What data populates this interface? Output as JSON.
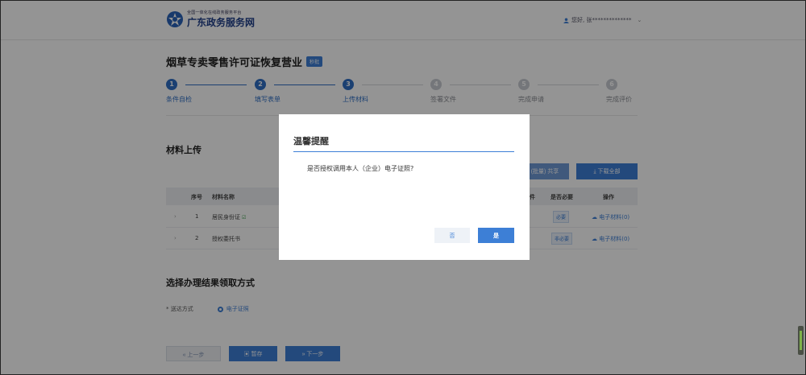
{
  "header": {
    "logo_sub": "全国一体化在线政务服务平台",
    "logo_main": "广东政务服务网",
    "user_text": "您好, 张**************"
  },
  "main": {
    "title": "烟草专卖零售许可证恢复营业",
    "badge": "秒批",
    "steps": [
      {
        "num": "1",
        "label": "条件自检",
        "state": "done"
      },
      {
        "num": "2",
        "label": "填写表单",
        "state": "done"
      },
      {
        "num": "3",
        "label": "上传材料",
        "state": "current"
      },
      {
        "num": "4",
        "label": "签署文件",
        "state": "todo"
      },
      {
        "num": "5",
        "label": "完成申请",
        "state": "todo"
      },
      {
        "num": "6",
        "label": "完成评价",
        "state": "todo"
      }
    ],
    "materials_title": "材料上传",
    "partial_button": "(批量) 共享",
    "download_all": "下载全部",
    "table_headers": {
      "index": "序号",
      "name": "材料名称",
      "file": "件",
      "required": "是否必要",
      "action": "操作"
    },
    "rows": [
      {
        "index": "1",
        "name": "居民身份证",
        "required": "必要",
        "action": "电子材料(0)"
      },
      {
        "index": "2",
        "name": "授权委托书",
        "required": "非必要",
        "action": "电子材料(0)"
      }
    ],
    "receive_title": "选择办理结果领取方式",
    "receive_label": "* 送达方式",
    "receive_option": "电子证照",
    "btn_prev": "上一步",
    "btn_save": "暂存",
    "btn_next": "下一步"
  },
  "modal": {
    "title": "温馨提醒",
    "message": "是否授权调用本人（企业）电子证照?",
    "no": "否",
    "yes": "是"
  },
  "colors": {
    "accent": "#3d7fd6",
    "overlay": "#000000"
  }
}
